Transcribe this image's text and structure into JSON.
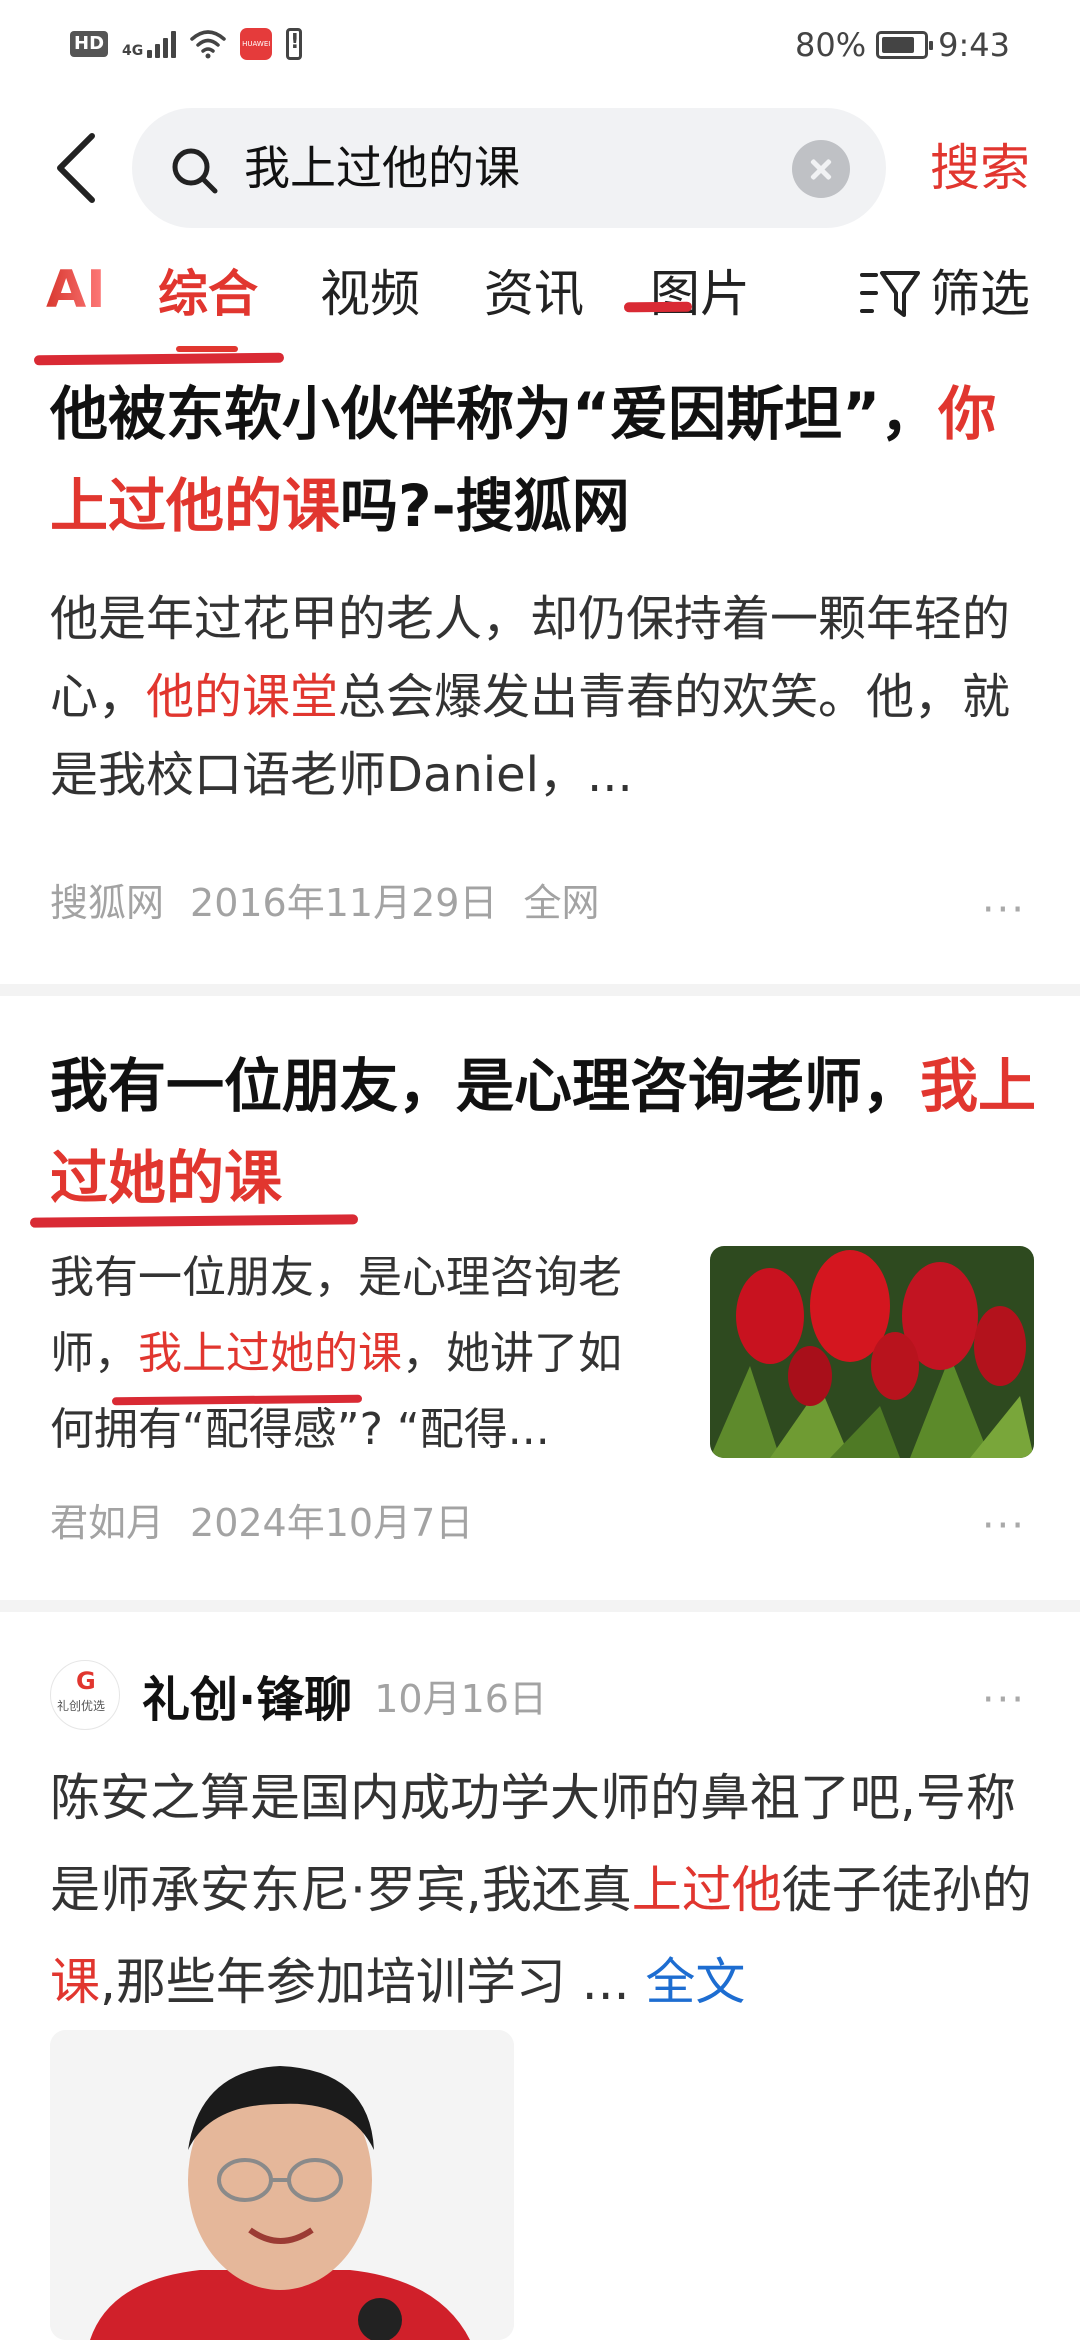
{
  "status_bar": {
    "hd": "HD",
    "network": "4G",
    "app_badge": "HUAWEI",
    "battery_percent": "80%",
    "battery_level": 0.8,
    "time": "9:43"
  },
  "search": {
    "query": "我上过他的课",
    "submit_label": "搜索"
  },
  "tabs": {
    "ai": "AI",
    "items": [
      "综合",
      "视频",
      "资讯",
      "图片"
    ],
    "active_index": 0,
    "filter_label": "筛选"
  },
  "results": [
    {
      "title_pre": "他被东软小伙伴称为“爱因斯坦”，",
      "title_hl": "你上过他的课",
      "title_post": "吗?-搜狐网",
      "snippet_pre": "他是年过花甲的老人，却仍保持着一颗年轻的心，",
      "snippet_hl": "他的课堂",
      "snippet_post": "总会爆发出青春的欢笑。他，就是我校口语老师Daniel，...",
      "source": "搜狐网",
      "date": "2016年11月29日",
      "scope": "全网",
      "more": "···"
    },
    {
      "title_pre": "我有一位朋友，是心理咨询老师，",
      "title_hl": "我上过她的课",
      "snippet_pre": "我有一位朋友，是心理咨询老师，",
      "snippet_hl": "我上过她的课",
      "snippet_post": "，她讲了如何拥有“配得感”? “配得...",
      "source": "君如月",
      "date": "2024年10月7日",
      "more": "···"
    },
    {
      "avatar_mark": "G",
      "avatar_caption": "礼创优选",
      "author": "礼创·锋聊",
      "date": "10月16日",
      "more": "···",
      "body_pre": "陈安之算是国内成功学大师的鼻祖了吧,号称是师承安东尼·罗宾,我还真",
      "body_hl1": "上过他",
      "body_mid": "徒子徒孙的",
      "body_hl2": "课",
      "body_post": ",那些年参加培训学习",
      "ellipsis": " ...",
      "full_text_link": "全文"
    }
  ],
  "colors": {
    "accent": "#e1362f",
    "link": "#1d6dd1",
    "meta": "#a3a3a3",
    "search_bg": "#f1f2f4"
  },
  "icons": {
    "back": "chevron-left-icon",
    "search": "search-icon",
    "clear": "close-circle-icon",
    "filter": "filter-icon",
    "more": "more-dots-icon"
  }
}
